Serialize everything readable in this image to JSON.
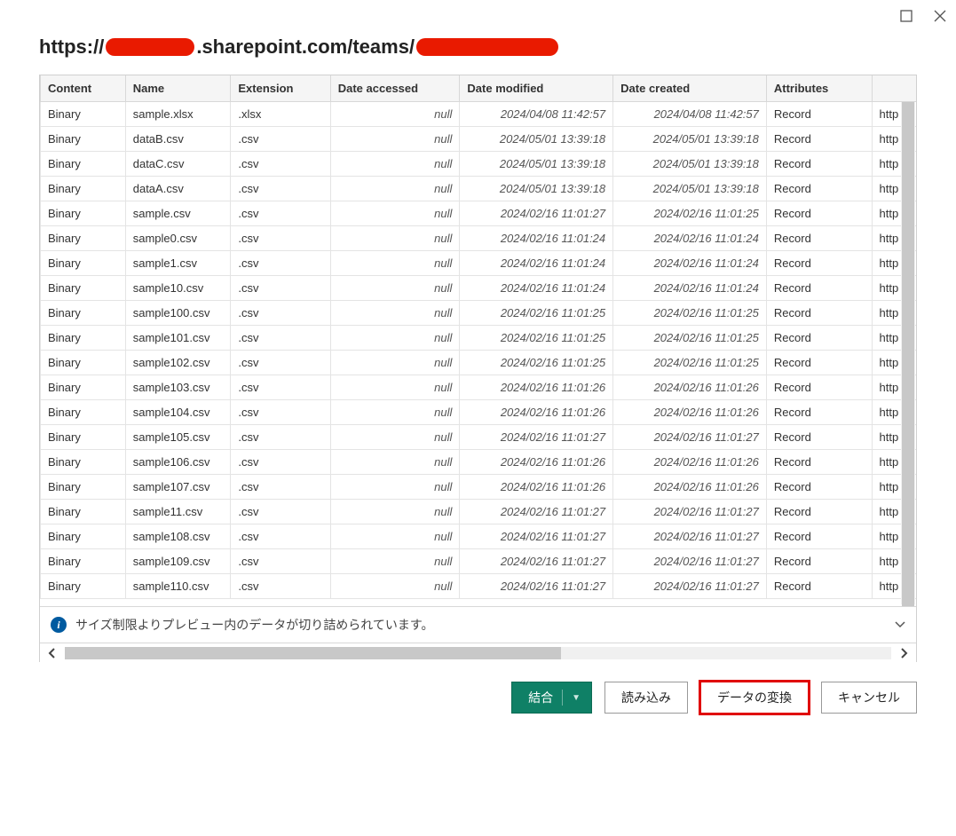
{
  "window": {
    "maximize_label": "maximize",
    "close_label": "close"
  },
  "title": {
    "prefix": "https://",
    "mid": ".sharepoint.com/teams/"
  },
  "columns": {
    "content": "Content",
    "name": "Name",
    "extension": "Extension",
    "date_accessed": "Date accessed",
    "date_modified": "Date modified",
    "date_created": "Date created",
    "attributes": "Attributes",
    "folder_path": "http"
  },
  "null_text": "null",
  "rows": [
    {
      "content": "Binary",
      "name": "sample.xlsx",
      "ext": ".xlsx",
      "acc": null,
      "mod": "2024/04/08 11:42:57",
      "cre": "2024/04/08 11:42:57",
      "attr": "Record",
      "path": "http"
    },
    {
      "content": "Binary",
      "name": "dataB.csv",
      "ext": ".csv",
      "acc": null,
      "mod": "2024/05/01 13:39:18",
      "cre": "2024/05/01 13:39:18",
      "attr": "Record",
      "path": "http"
    },
    {
      "content": "Binary",
      "name": "dataC.csv",
      "ext": ".csv",
      "acc": null,
      "mod": "2024/05/01 13:39:18",
      "cre": "2024/05/01 13:39:18",
      "attr": "Record",
      "path": "http"
    },
    {
      "content": "Binary",
      "name": "dataA.csv",
      "ext": ".csv",
      "acc": null,
      "mod": "2024/05/01 13:39:18",
      "cre": "2024/05/01 13:39:18",
      "attr": "Record",
      "path": "http"
    },
    {
      "content": "Binary",
      "name": "sample.csv",
      "ext": ".csv",
      "acc": null,
      "mod": "2024/02/16 11:01:27",
      "cre": "2024/02/16 11:01:25",
      "attr": "Record",
      "path": "http"
    },
    {
      "content": "Binary",
      "name": "sample0.csv",
      "ext": ".csv",
      "acc": null,
      "mod": "2024/02/16 11:01:24",
      "cre": "2024/02/16 11:01:24",
      "attr": "Record",
      "path": "http"
    },
    {
      "content": "Binary",
      "name": "sample1.csv",
      "ext": ".csv",
      "acc": null,
      "mod": "2024/02/16 11:01:24",
      "cre": "2024/02/16 11:01:24",
      "attr": "Record",
      "path": "http"
    },
    {
      "content": "Binary",
      "name": "sample10.csv",
      "ext": ".csv",
      "acc": null,
      "mod": "2024/02/16 11:01:24",
      "cre": "2024/02/16 11:01:24",
      "attr": "Record",
      "path": "http"
    },
    {
      "content": "Binary",
      "name": "sample100.csv",
      "ext": ".csv",
      "acc": null,
      "mod": "2024/02/16 11:01:25",
      "cre": "2024/02/16 11:01:25",
      "attr": "Record",
      "path": "http"
    },
    {
      "content": "Binary",
      "name": "sample101.csv",
      "ext": ".csv",
      "acc": null,
      "mod": "2024/02/16 11:01:25",
      "cre": "2024/02/16 11:01:25",
      "attr": "Record",
      "path": "http"
    },
    {
      "content": "Binary",
      "name": "sample102.csv",
      "ext": ".csv",
      "acc": null,
      "mod": "2024/02/16 11:01:25",
      "cre": "2024/02/16 11:01:25",
      "attr": "Record",
      "path": "http"
    },
    {
      "content": "Binary",
      "name": "sample103.csv",
      "ext": ".csv",
      "acc": null,
      "mod": "2024/02/16 11:01:26",
      "cre": "2024/02/16 11:01:26",
      "attr": "Record",
      "path": "http"
    },
    {
      "content": "Binary",
      "name": "sample104.csv",
      "ext": ".csv",
      "acc": null,
      "mod": "2024/02/16 11:01:26",
      "cre": "2024/02/16 11:01:26",
      "attr": "Record",
      "path": "http"
    },
    {
      "content": "Binary",
      "name": "sample105.csv",
      "ext": ".csv",
      "acc": null,
      "mod": "2024/02/16 11:01:27",
      "cre": "2024/02/16 11:01:27",
      "attr": "Record",
      "path": "http"
    },
    {
      "content": "Binary",
      "name": "sample106.csv",
      "ext": ".csv",
      "acc": null,
      "mod": "2024/02/16 11:01:26",
      "cre": "2024/02/16 11:01:26",
      "attr": "Record",
      "path": "http"
    },
    {
      "content": "Binary",
      "name": "sample107.csv",
      "ext": ".csv",
      "acc": null,
      "mod": "2024/02/16 11:01:26",
      "cre": "2024/02/16 11:01:26",
      "attr": "Record",
      "path": "http"
    },
    {
      "content": "Binary",
      "name": "sample11.csv",
      "ext": ".csv",
      "acc": null,
      "mod": "2024/02/16 11:01:27",
      "cre": "2024/02/16 11:01:27",
      "attr": "Record",
      "path": "http"
    },
    {
      "content": "Binary",
      "name": "sample108.csv",
      "ext": ".csv",
      "acc": null,
      "mod": "2024/02/16 11:01:27",
      "cre": "2024/02/16 11:01:27",
      "attr": "Record",
      "path": "http"
    },
    {
      "content": "Binary",
      "name": "sample109.csv",
      "ext": ".csv",
      "acc": null,
      "mod": "2024/02/16 11:01:27",
      "cre": "2024/02/16 11:01:27",
      "attr": "Record",
      "path": "http"
    },
    {
      "content": "Binary",
      "name": "sample110.csv",
      "ext": ".csv",
      "acc": null,
      "mod": "2024/02/16 11:01:27",
      "cre": "2024/02/16 11:01:27",
      "attr": "Record",
      "path": "http"
    }
  ],
  "info_message": "サイズ制限よりプレビュー内のデータが切り詰められています。",
  "buttons": {
    "combine": "結合",
    "load": "読み込み",
    "transform": "データの変換",
    "cancel": "キャンセル"
  }
}
